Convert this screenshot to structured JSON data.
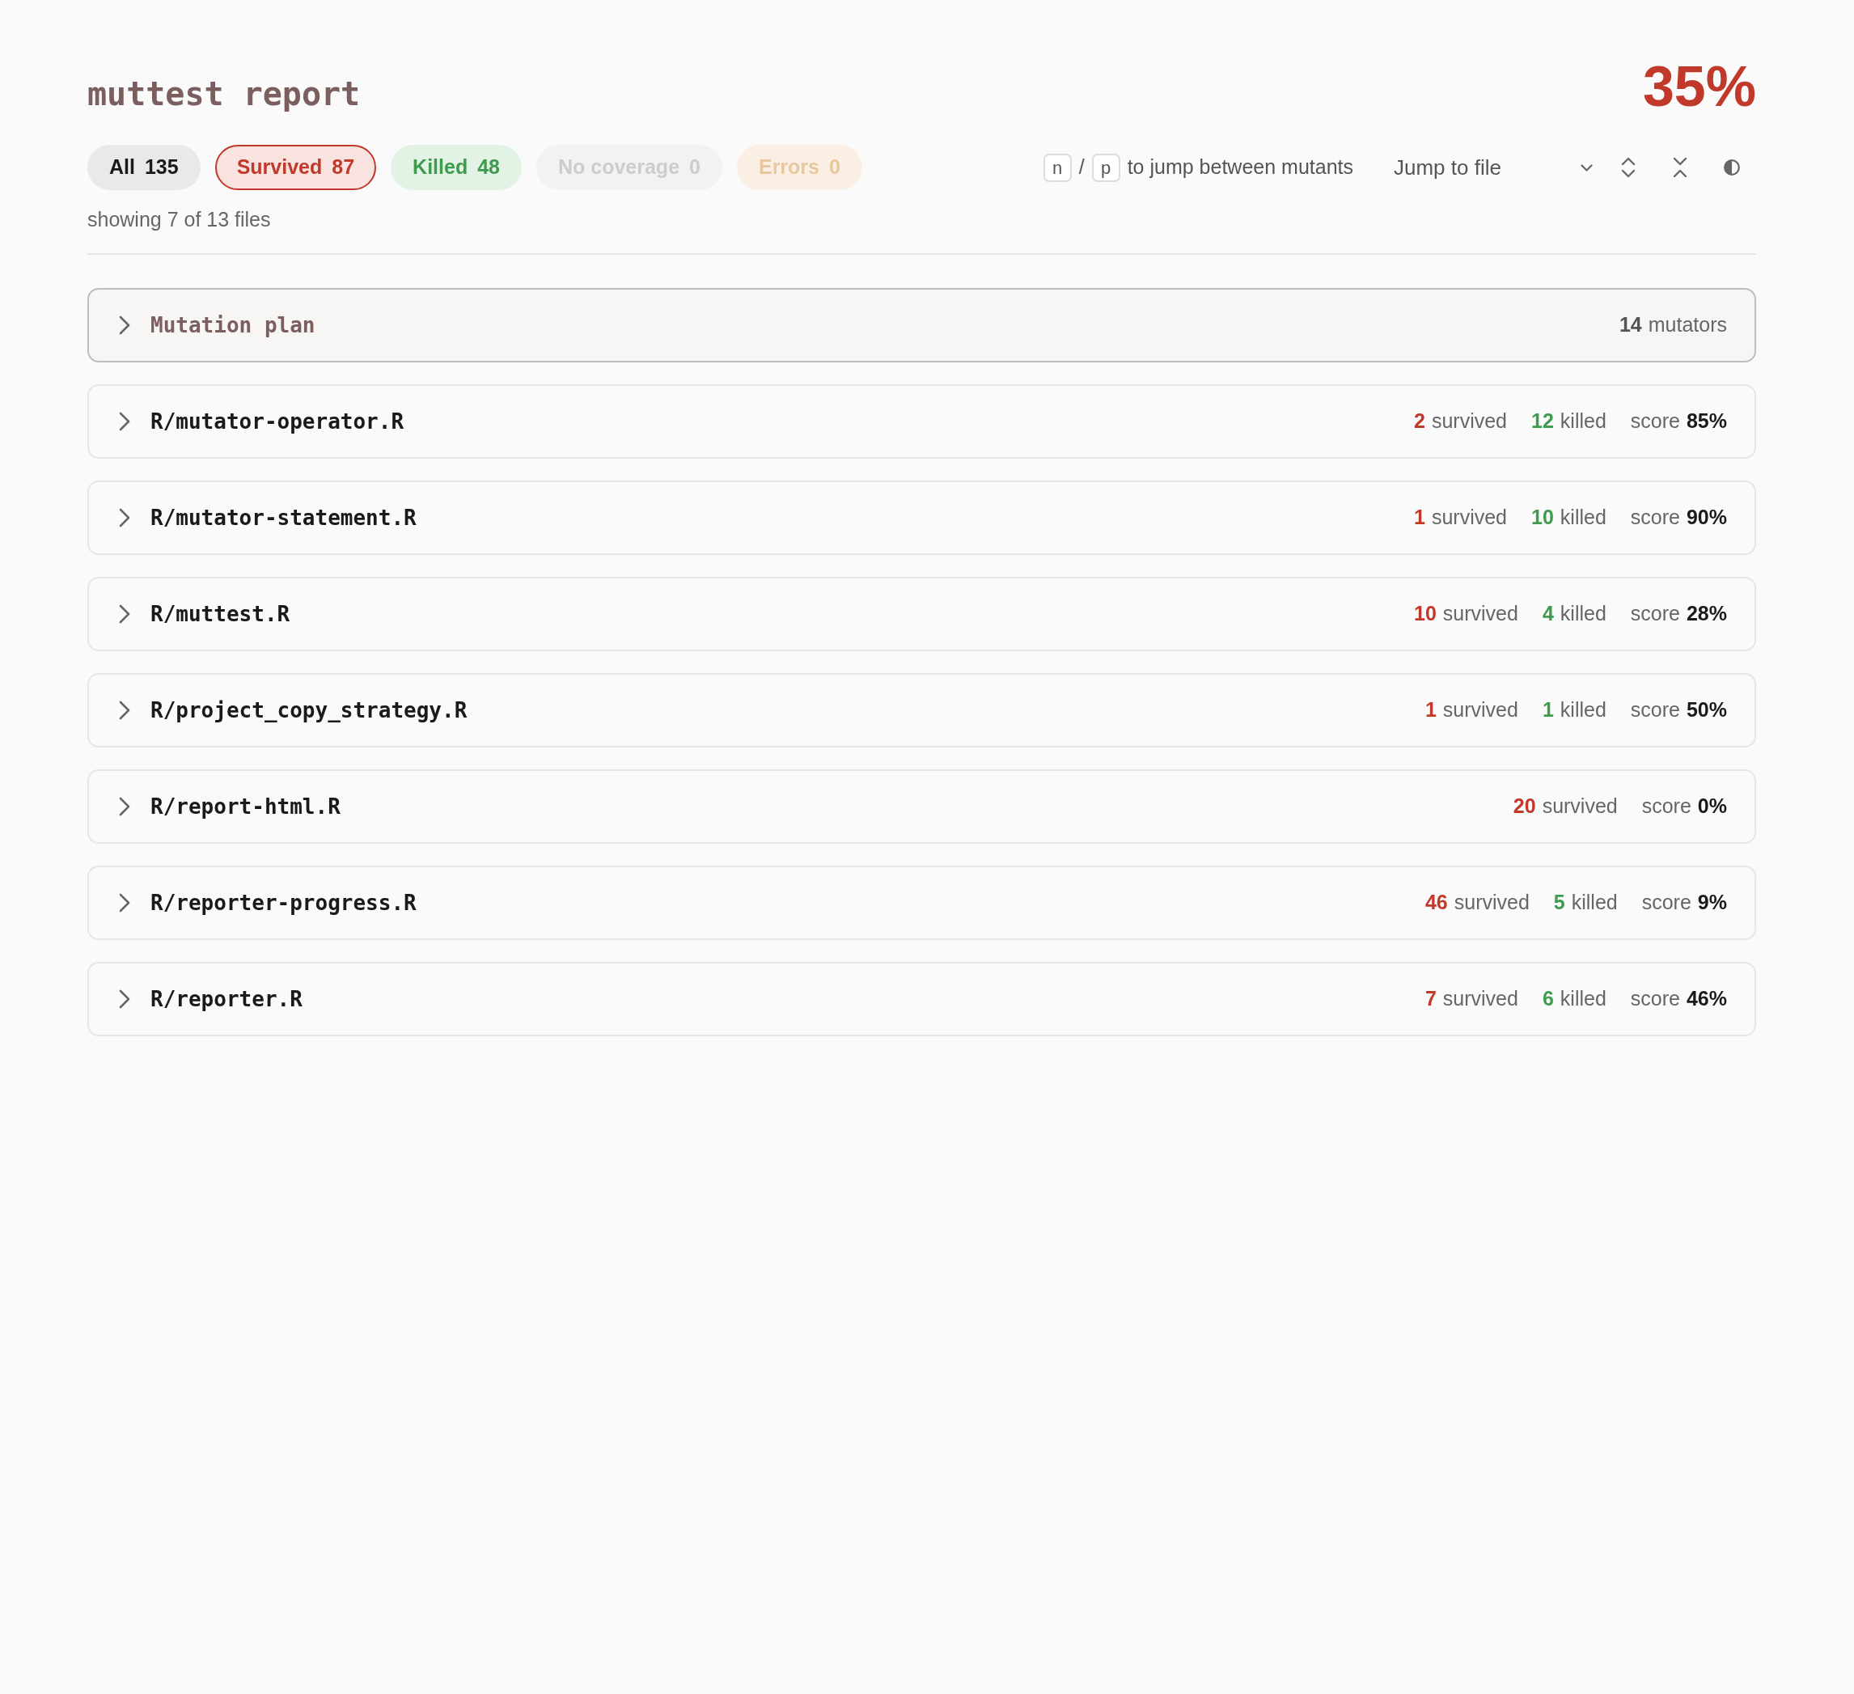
{
  "title": "muttest report",
  "score": "35%",
  "filters": [
    {
      "kind": "all",
      "label": "All",
      "count": "135",
      "selected": false,
      "disabled": false
    },
    {
      "kind": "survived",
      "label": "Survived",
      "count": "87",
      "selected": true,
      "disabled": false
    },
    {
      "kind": "killed",
      "label": "Killed",
      "count": "48",
      "selected": false,
      "disabled": false
    },
    {
      "kind": "no_coverage",
      "label": "No coverage",
      "count": "0",
      "selected": false,
      "disabled": true
    },
    {
      "kind": "errors",
      "label": "Errors",
      "count": "0",
      "selected": false,
      "disabled": true
    }
  ],
  "summary": "showing 7 of 13 files",
  "shortcut_hint": {
    "keys": [
      "n",
      "p"
    ],
    "separator": "/",
    "text": "to jump between mutants"
  },
  "jump_dropdown": {
    "text": "Jump to file"
  },
  "sections": [
    {
      "kind": "plan",
      "title": "Mutation plan",
      "expanded": false,
      "stats": [
        {
          "kind": "mutators",
          "count": "14",
          "noun": "mutators"
        }
      ]
    },
    {
      "kind": "file",
      "title": "R/mutator-operator.R",
      "expanded": false,
      "stats": [
        {
          "kind": "survived",
          "count": "2",
          "noun": "survived"
        },
        {
          "kind": "killed",
          "count": "12",
          "noun": "killed"
        },
        {
          "kind": "score",
          "label": "score",
          "value": "85%"
        }
      ]
    },
    {
      "kind": "file",
      "title": "R/mutator-statement.R",
      "expanded": false,
      "stats": [
        {
          "kind": "survived",
          "count": "1",
          "noun": "survived"
        },
        {
          "kind": "killed",
          "count": "10",
          "noun": "killed"
        },
        {
          "kind": "score",
          "label": "score",
          "value": "90%"
        }
      ]
    },
    {
      "kind": "file",
      "title": "R/muttest.R",
      "expanded": false,
      "stats": [
        {
          "kind": "survived",
          "count": "10",
          "noun": "survived"
        },
        {
          "kind": "killed",
          "count": "4",
          "noun": "killed"
        },
        {
          "kind": "score",
          "label": "score",
          "value": "28%"
        }
      ]
    },
    {
      "kind": "file",
      "title": "R/project_copy_strategy.R",
      "expanded": false,
      "stats": [
        {
          "kind": "survived",
          "count": "1",
          "noun": "survived"
        },
        {
          "kind": "killed",
          "count": "1",
          "noun": "killed"
        },
        {
          "kind": "score",
          "label": "score",
          "value": "50%"
        }
      ]
    },
    {
      "kind": "file",
      "title": "R/report-html.R",
      "expanded": false,
      "stats": [
        {
          "kind": "survived",
          "count": "20",
          "noun": "survived"
        },
        {
          "kind": "score",
          "label": "score",
          "value": "0%"
        }
      ]
    },
    {
      "kind": "file",
      "title": "R/reporter-progress.R",
      "expanded": false,
      "stats": [
        {
          "kind": "survived",
          "count": "46",
          "noun": "survived"
        },
        {
          "kind": "killed",
          "count": "5",
          "noun": "killed"
        },
        {
          "kind": "score",
          "label": "score",
          "value": "9%"
        }
      ]
    },
    {
      "kind": "file",
      "title": "R/reporter.R",
      "expanded": false,
      "stats": [
        {
          "kind": "survived",
          "count": "7",
          "noun": "survived"
        },
        {
          "kind": "killed",
          "count": "6",
          "noun": "killed"
        },
        {
          "kind": "score",
          "label": "score",
          "value": "46%"
        }
      ]
    }
  ]
}
